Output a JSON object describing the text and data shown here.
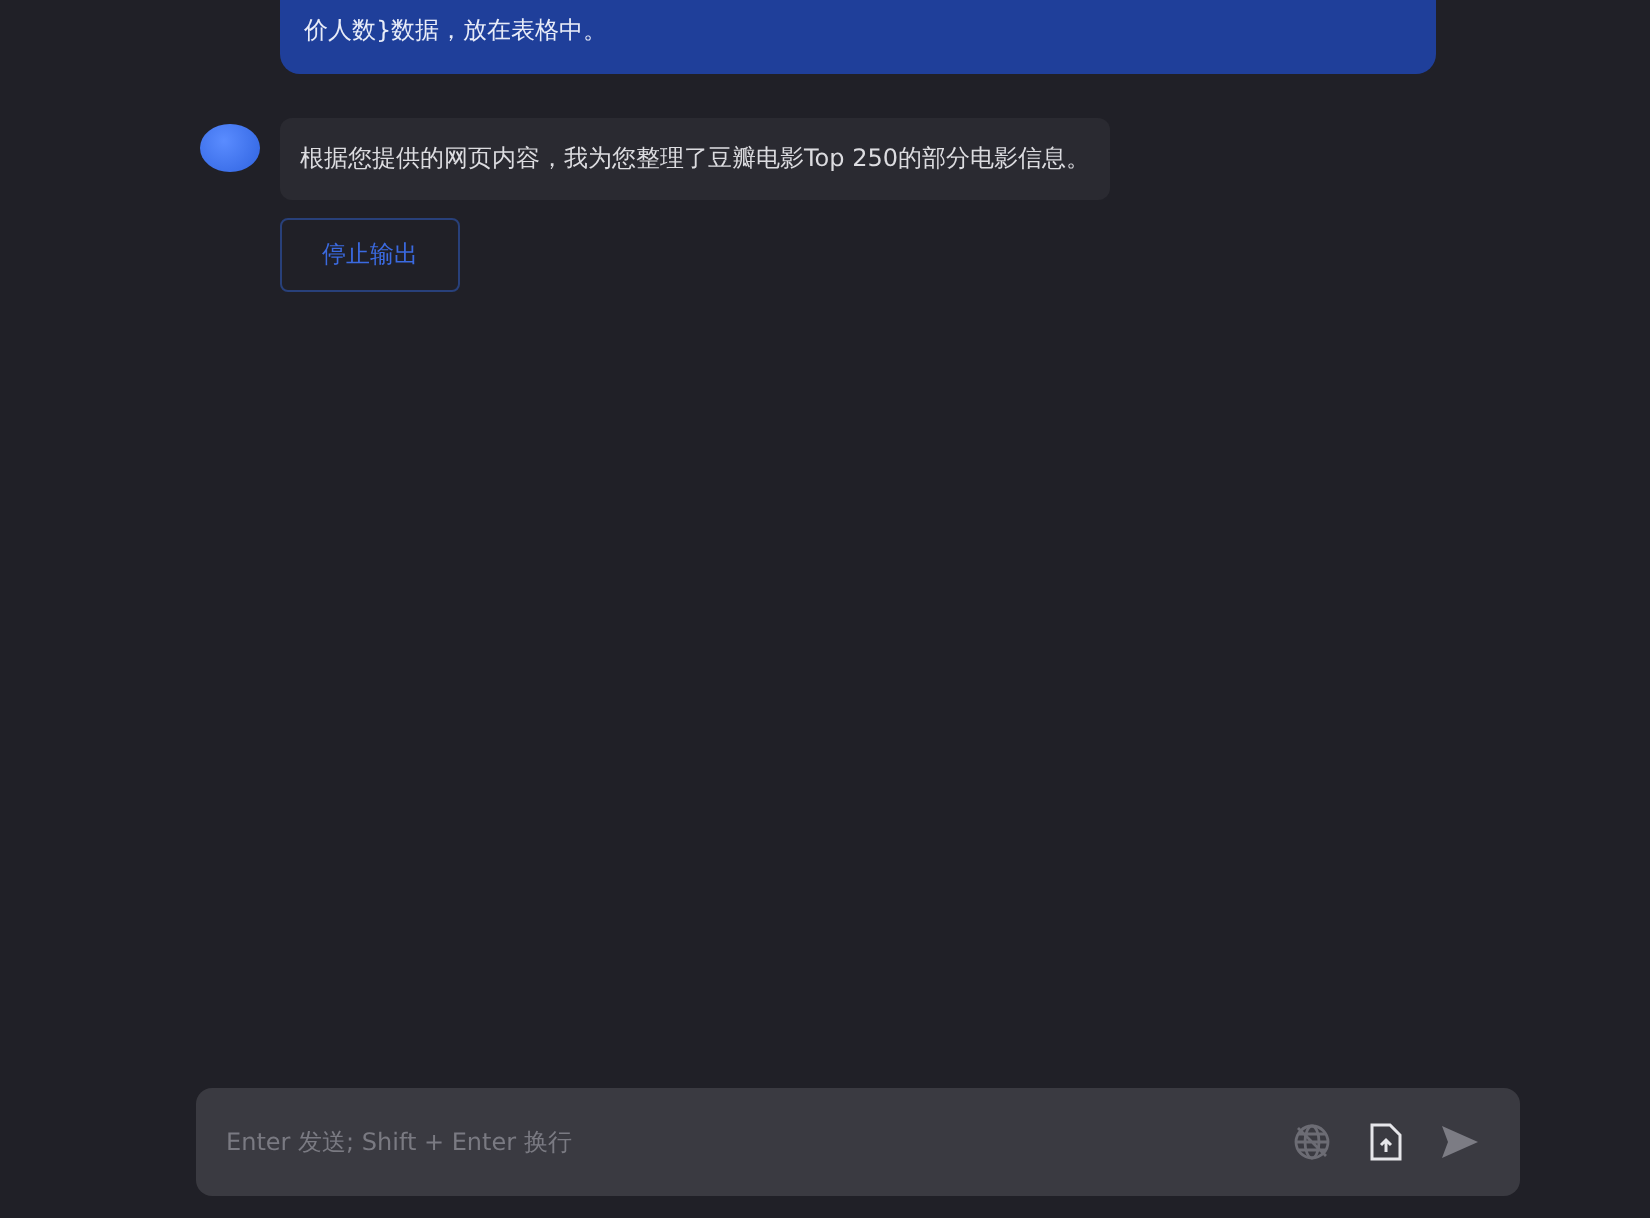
{
  "messages": [
    {
      "kind": "user",
      "text": "价人数}数据，放在表格中。"
    },
    {
      "kind": "assistant",
      "text": "根据您提供的网页内容，我为您整理了豆瓣电影Top 250的部分电影信息。"
    }
  ],
  "stop_button": {
    "label": "停止输出"
  },
  "composer": {
    "placeholder": "Enter 发送; Shift + Enter 换行"
  }
}
